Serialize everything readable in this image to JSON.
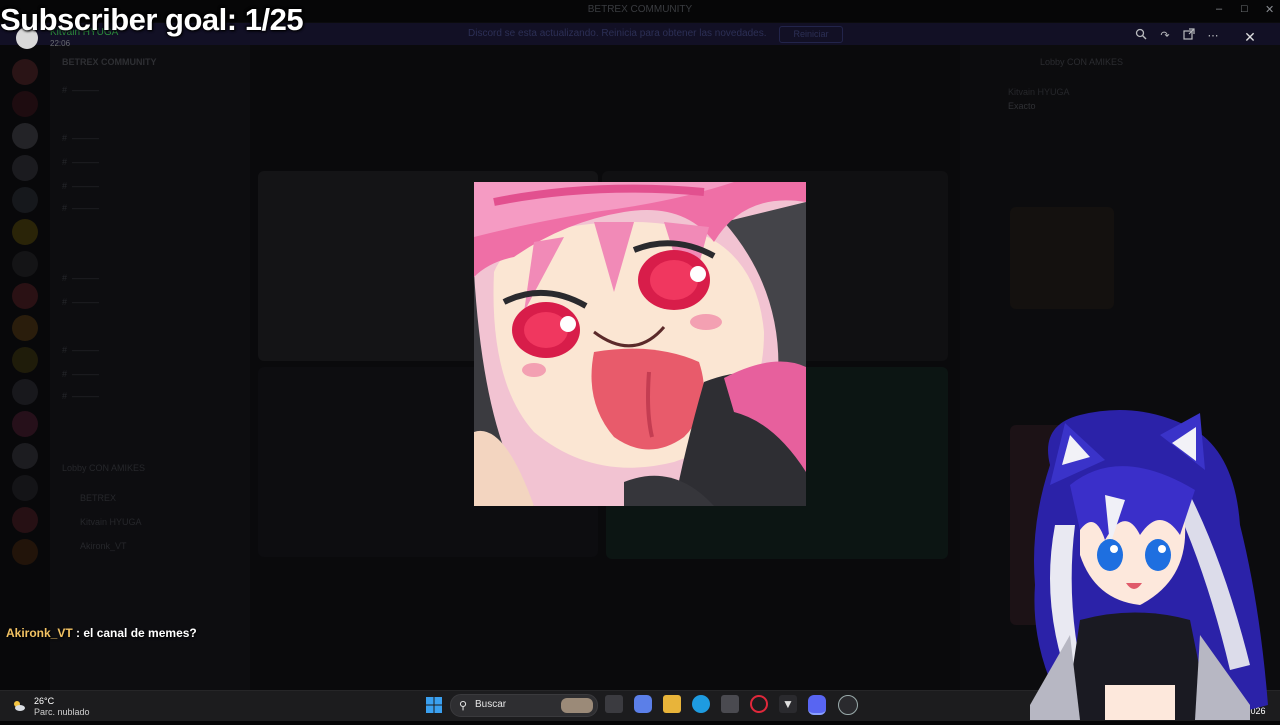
{
  "overlay": {
    "subscriber_goal": "Subscriber goal: 1/25",
    "chat": {
      "user": "Akironk_VT",
      "separator": " : ",
      "message": "el canal de memes?"
    }
  },
  "discord": {
    "window_title": "BETREX COMMUNITY",
    "banner_text": "Discord se esta actualizando. Reinicia para obtener las novedades.",
    "banner_button": "Reiniciar",
    "server_name": "BETREX COMMUNITY",
    "voice_channel": "Lobby CON AMIKES",
    "viewer": {
      "poster": "Kitvain HYUGA",
      "time": "22:06"
    },
    "members": [
      "Kitvain HYUGA",
      "BETREX",
      "Akironk_VT"
    ],
    "messages": [
      {
        "user": "Kitvain HYUGA",
        "text": "Exacto"
      }
    ]
  },
  "taskbar": {
    "weather_temp": "26°C",
    "weather_condition": "Parc. nublado",
    "search_label": "Buscar",
    "clock_fragment": "/2026"
  },
  "colors": {
    "accent_chat_user": "#f2c263",
    "profile_name": "#2b8c3c",
    "banner": "#121025"
  },
  "icons": [
    "zoom-icon",
    "forward-icon",
    "open-external-icon",
    "more-icon",
    "close-icon",
    "windows-start-icon",
    "search-icon"
  ]
}
